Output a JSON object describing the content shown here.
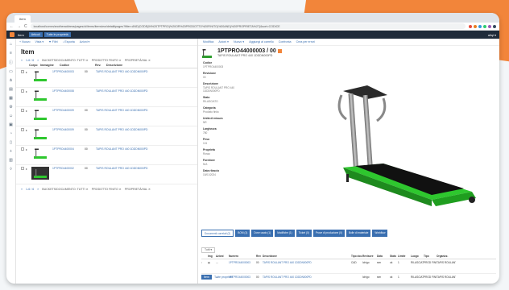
{
  "browser": {
    "tab_label": "Item",
    "address": "localhost/comm/anotheraddress/pages/ui/items/itemview/detail#pages?filter=AND(CODE(IN%20TPTPRO)%20OR%20PRODOTTO%20FINITO)%20AND(%20PROPRIETA%27)&sort=CODICE",
    "nav_symbols": [
      "←",
      "→",
      "C"
    ]
  },
  "appbar": {
    "app_name": "Item",
    "chips": [
      "Articoli",
      "Tutte le proprietà"
    ],
    "right_label": "aliqi ▾"
  },
  "left_nav_icons": [
    "home-icon",
    "list-icon",
    "info-icon",
    "folder-icon",
    "tree-icon",
    "chart-icon",
    "grid-icon",
    "settings-icon",
    "users-icon",
    "box-icon",
    "gauge-icon",
    "doc-icon",
    "plus-icon",
    "calendar-icon",
    "bell-icon"
  ],
  "list": {
    "toolbar": [
      "+ Nuovo",
      "Vista ▾",
      "▼ Filtri",
      "↓ Esporta",
      "Azioni ▾"
    ],
    "title": "Item",
    "pager": {
      "range_prev": "«",
      "range": "1-6 / 6",
      "range_next": "»",
      "filters": [
        "BUCKETS/DOCUMENTO: TUTTI ✕",
        "PRODOTTO FINITO ✕",
        "PROPRIETÀ/VAL ✕"
      ]
    },
    "columns": [
      "Corpo",
      "Immagine",
      "Codice",
      "Rev.",
      "Descrizione"
    ],
    "rows": [
      {
        "code": "1PTPRO4400003",
        "rev": "00",
        "desc": "TAPIS ROULANT PRO 440 1DDDN000PD"
      },
      {
        "code": "1PTPRO4400008",
        "rev": "",
        "desc": "TAPIS ROULANT PRO 440 1DDDN000PD"
      },
      {
        "code": "1PTPRO4400009",
        "rev": "00",
        "desc": "TAPIS ROULANT PRO 440 1DDDN000PD"
      },
      {
        "code": "1PTPRO4400009",
        "rev": "00",
        "desc": "TAPIS ROULANT PRO 440 1DDDN000PD"
      },
      {
        "code": "1PTPRO4400004",
        "rev": "00",
        "desc": "TAPIS ROULANT PRO 440 1DDDN000PD"
      },
      {
        "code": "1PTPRO4400002",
        "rev": "00",
        "desc": "TAPIS ROULANT PRO 440 1DDDN000PD"
      }
    ],
    "pager_bottom": {
      "range_prev": "«",
      "range": "1-6 / 6",
      "range_next": "»",
      "filters": [
        "BUCKETS/DOCUMENTO: TUTTI ✕",
        "PRODOTTO FINITO ✕",
        "PROPRIETÀ/VAL ✕"
      ]
    }
  },
  "detail": {
    "toolbar": [
      "Modifica",
      "Azioni ▾",
      "Nuovo ▾",
      "Aggiungi al carrello",
      "Confronta",
      "Crea per errori"
    ],
    "title": "1PTPRO44000003 / 00",
    "subtitle": "TAPIS ROULANT PRO 440 1DDDN000PD",
    "fields": [
      {
        "label": "Codice",
        "value": "1PTPRO4400003"
      },
      {
        "label": "Revisione",
        "value": "00"
      },
      {
        "label": "Descrizione",
        "value": "TAPIS ROULANT PRO 440 1DDDN000PD"
      },
      {
        "label": "Stato",
        "value": "RILASCIATO"
      },
      {
        "label": "Categoria",
        "value": "Prodotto finito"
      },
      {
        "label": "Unità di misura",
        "value": "NR"
      },
      {
        "label": "Larghezza",
        "value": "780"
      },
      {
        "label": "Peso",
        "value": "101"
      },
      {
        "label": "Proprietà",
        "value": "Rosso"
      },
      {
        "label": "Fornitore",
        "value": "N/A"
      },
      {
        "label": "Data rilascio",
        "value": "15/01/2024"
      }
    ],
    "subtabs": [
      "Documenti correlati (2)",
      "BOM (3)",
      "Dove usato (1)",
      "Modifiche (1)",
      "Ticket (0)",
      "Prove di produzione (0)",
      "Bolle di materiale",
      "Workflow"
    ],
    "subtable": {
      "filter": "Tutti ▾",
      "columns": [
        "",
        "Img",
        "Azioni",
        "Numero",
        "Rev",
        "Descrizione",
        "Tipo doc.",
        "Revisore",
        "Data",
        "Stato",
        "Limite",
        "Luogo",
        "Tipo",
        "Organizz."
      ],
      "rows": [
        {
          "num": "1PTPRO44000003",
          "rev": "00",
          "desc": "TAPIS ROULANT PRO 440 1DDDN000PD",
          "type": "CAD",
          "user": "Ichigo",
          "date": "sen",
          "state": "ok",
          "limit": "1",
          "place": "RILASCIATO",
          "t": "PROD FINITO",
          "org": "TAPIS ROULANT"
        },
        {
          "num": "1PTPRO44000003",
          "rev": "00",
          "desc": "TAPIS ROULANT PRO 440 1DDDN000PD",
          "type": "",
          "user": "Ichigo",
          "date": "sen",
          "state": "ok",
          "limit": "1",
          "place": "RILASCIATO",
          "t": "PROD FINITO",
          "org": "TAPIS ROULANT"
        }
      ]
    }
  },
  "footer": {
    "tab_on": "Item",
    "tab_off": "Tutte proprietà"
  },
  "colors": {
    "accent": "#f2853a",
    "navy": "#1f2b3a",
    "link": "#3a6fb0",
    "treadmill_green": "#3cc83c"
  }
}
